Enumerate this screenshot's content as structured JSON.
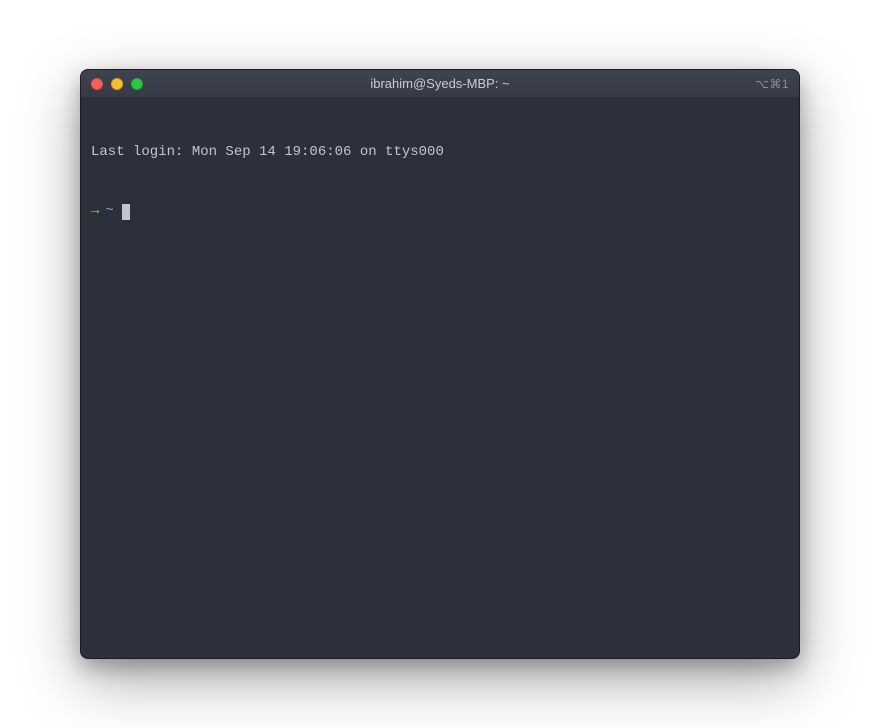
{
  "window": {
    "title": "ibrahim@Syeds-MBP: ~",
    "shortcut_hint": "⌥⌘1"
  },
  "terminal": {
    "last_login": "Last login: Mon Sep 14 19:06:06 on ttys000",
    "prompt_arrow": "→",
    "prompt_path": "~"
  },
  "colors": {
    "background": "#2b303b",
    "foreground": "#c0c5ce",
    "prompt_arrow": "#98c379",
    "prompt_path": "#61afef",
    "traffic_red": "#ff5f56",
    "traffic_yellow": "#ffbd2e",
    "traffic_green": "#27c93f"
  }
}
